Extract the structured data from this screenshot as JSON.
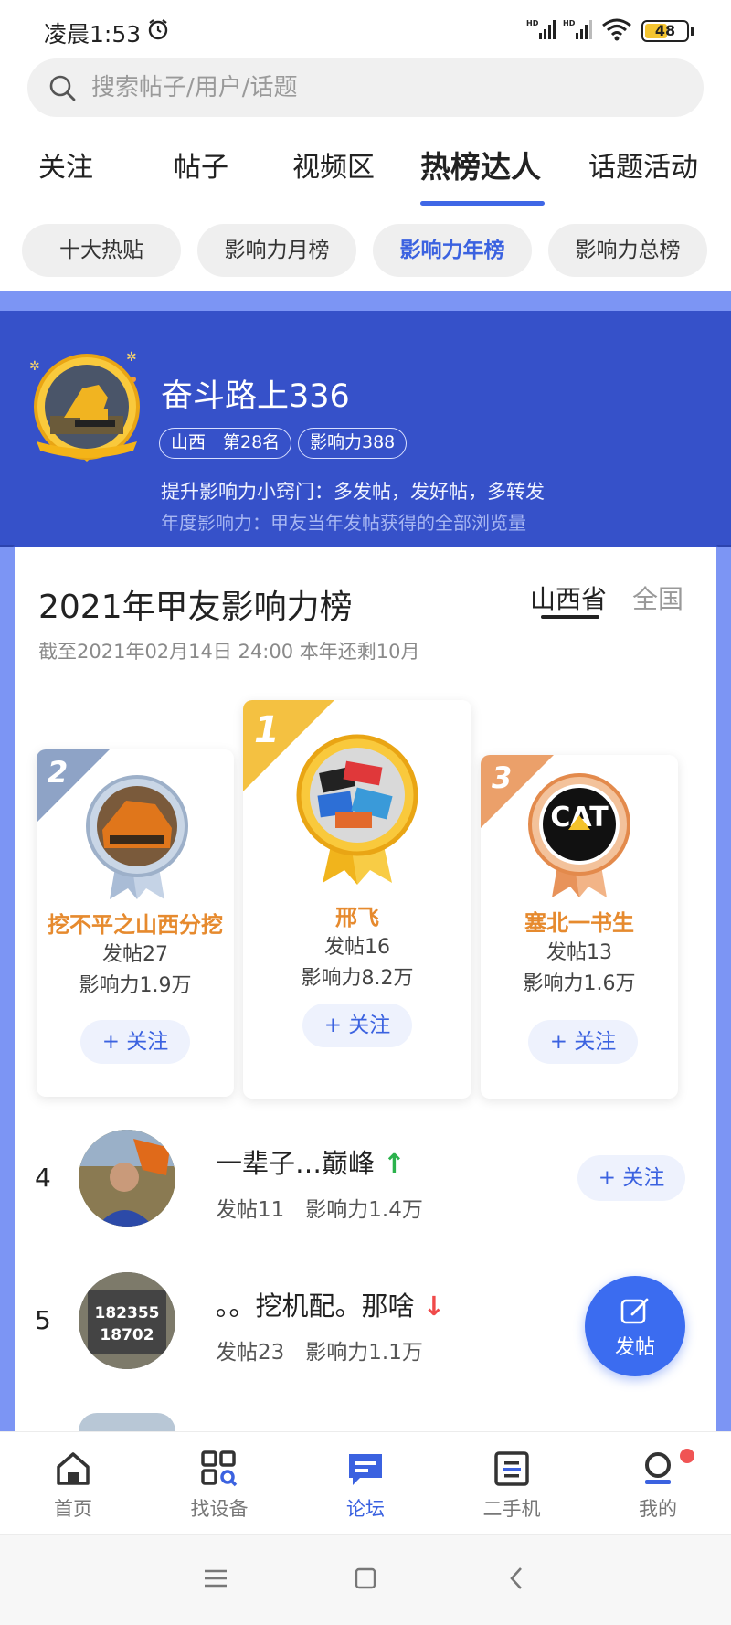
{
  "status_bar": {
    "time": "凌晨1:53",
    "battery": "48",
    "signal_label": "HD"
  },
  "search": {
    "placeholder": "搜索帖子/用户/话题"
  },
  "tabs": [
    {
      "label": "关注"
    },
    {
      "label": "帖子"
    },
    {
      "label": "视频区"
    },
    {
      "label": "热榜达人",
      "active": true
    },
    {
      "label": "话题活动"
    }
  ],
  "subtabs": [
    {
      "label": "十大热贴"
    },
    {
      "label": "影响力月榜"
    },
    {
      "label": "影响力年榜",
      "active": true
    },
    {
      "label": "影响力总榜"
    }
  ],
  "profile": {
    "name": "奋斗路上336",
    "region_rank": "山西　第28名",
    "influence": "影响力388",
    "tip": "提升影响力小窍门：多发帖，发好帖，多转发",
    "definition": "年度影响力：甲友当年发帖获得的全部浏览量"
  },
  "board": {
    "title": "2021年甲友影响力榜",
    "scope_tabs": [
      {
        "label": "山西省",
        "active": true
      },
      {
        "label": "全国"
      }
    ],
    "deadline": "截至2021年02月14日 24:00 本年还剩10月"
  },
  "podium": [
    {
      "rank": "1",
      "name": "邢飞",
      "posts": "发帖16",
      "influence": "影响力8.2万",
      "follow": "+ 关注",
      "medal_color": "#f4b418"
    },
    {
      "rank": "2",
      "name": "挖不平之山西分挖",
      "posts": "发帖27",
      "influence": "影响力1.9万",
      "follow": "+ 关注",
      "medal_color": "#9fb4cf"
    },
    {
      "rank": "3",
      "name": "塞北一书生",
      "posts": "发帖13",
      "influence": "影响力1.6万",
      "follow": "+ 关注",
      "medal_color": "#e9a16a"
    }
  ],
  "list": [
    {
      "rank": "4",
      "name": "一辈子…巅峰",
      "trend": "↑",
      "trend_dir": "up",
      "posts": "发帖11",
      "influence": "影响力1.4万",
      "follow": "+ 关注"
    },
    {
      "rank": "5",
      "name": "。。挖机配。那啥",
      "trend": "↓",
      "trend_dir": "down",
      "posts": "发帖23",
      "influence": "影响力1.1万",
      "avatar_text": "182355\n18702"
    }
  ],
  "fab": {
    "label": "发帖"
  },
  "bottom_nav": [
    {
      "label": "首页"
    },
    {
      "label": "找设备"
    },
    {
      "label": "论坛",
      "active": true
    },
    {
      "label": "二手机"
    },
    {
      "label": "我的"
    }
  ],
  "colors": {
    "accent": "#3b62e0",
    "banner": "#3651c9",
    "gold": "#f4b418",
    "silver": "#9fb4cf",
    "bronze": "#e9a16a",
    "up": "#2bb24c",
    "down": "#f04a4a"
  }
}
